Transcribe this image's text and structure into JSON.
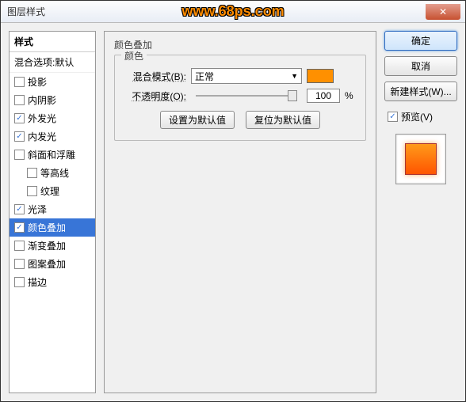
{
  "window": {
    "title": "图层样式"
  },
  "watermark": "www.68ps.com",
  "sidebar": {
    "header": "样式",
    "sub": "混合选项:默认",
    "items": [
      {
        "label": "投影",
        "checked": false,
        "indent": false
      },
      {
        "label": "内阴影",
        "checked": false,
        "indent": false
      },
      {
        "label": "外发光",
        "checked": true,
        "indent": false
      },
      {
        "label": "内发光",
        "checked": true,
        "indent": false
      },
      {
        "label": "斜面和浮雕",
        "checked": false,
        "indent": false
      },
      {
        "label": "等高线",
        "checked": false,
        "indent": true
      },
      {
        "label": "纹理",
        "checked": false,
        "indent": true
      },
      {
        "label": "光泽",
        "checked": true,
        "indent": false
      },
      {
        "label": "颜色叠加",
        "checked": true,
        "indent": false,
        "selected": true
      },
      {
        "label": "渐变叠加",
        "checked": false,
        "indent": false
      },
      {
        "label": "图案叠加",
        "checked": false,
        "indent": false
      },
      {
        "label": "描边",
        "checked": false,
        "indent": false
      }
    ]
  },
  "panel": {
    "title": "颜色叠加",
    "group": "颜色",
    "blend_label": "混合模式(B):",
    "blend_value": "正常",
    "swatch_color": "#ff9000",
    "opacity_label": "不透明度(O):",
    "opacity_value": "100",
    "opacity_unit": "%",
    "set_default": "设置为默认值",
    "reset_default": "复位为默认值"
  },
  "right": {
    "ok": "确定",
    "cancel": "取消",
    "new_style": "新建样式(W)...",
    "preview": "预览(V)"
  }
}
